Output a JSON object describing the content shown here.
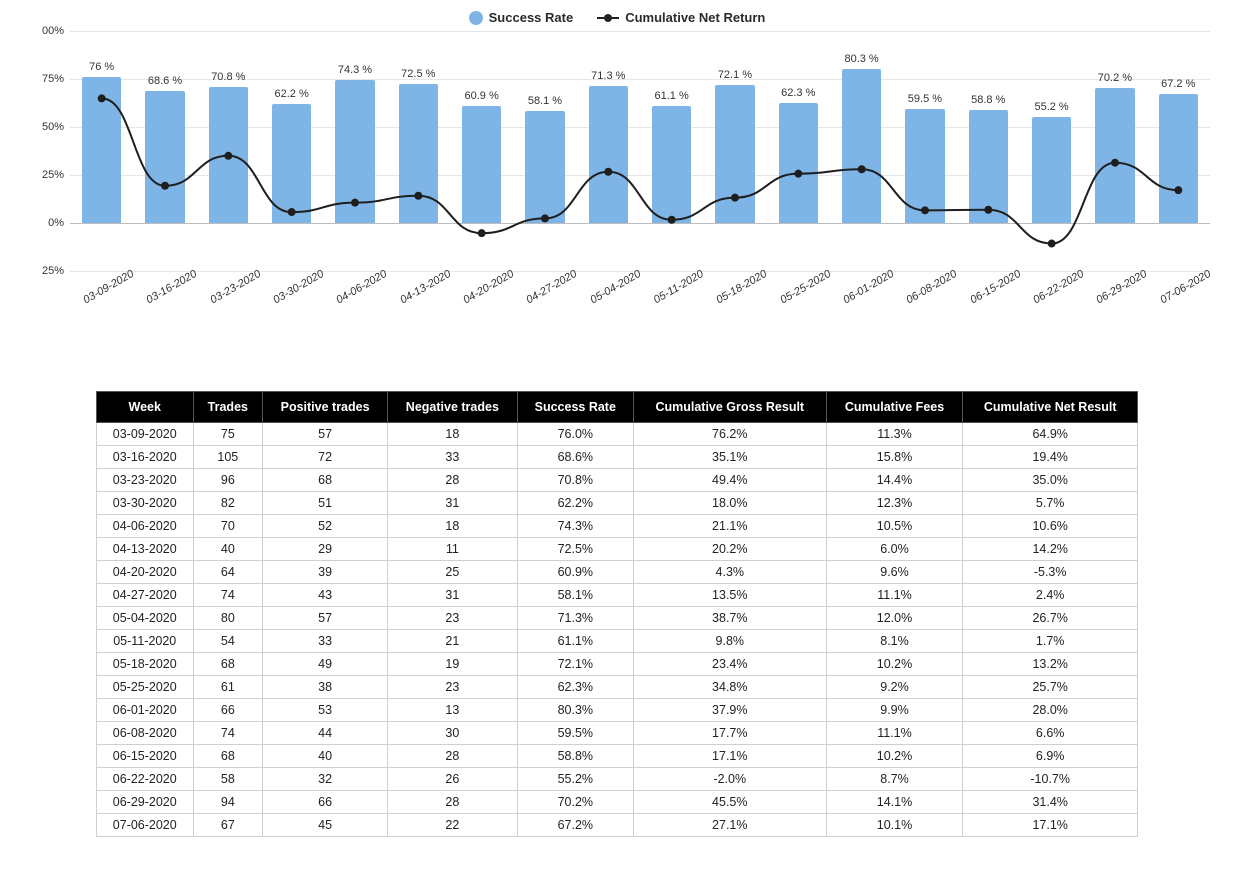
{
  "legend": {
    "bar_label": "Success Rate",
    "line_label": "Cumulative Net Return",
    "bar_color": "#7eb5e6",
    "line_color": "#1e1e1e"
  },
  "chart_data": {
    "type": "bar+line",
    "categories": [
      "03-09-2020",
      "03-16-2020",
      "03-23-2020",
      "03-30-2020",
      "04-06-2020",
      "04-13-2020",
      "04-20-2020",
      "04-27-2020",
      "05-04-2020",
      "05-11-2020",
      "05-18-2020",
      "05-25-2020",
      "06-01-2020",
      "06-08-2020",
      "06-15-2020",
      "06-22-2020",
      "06-29-2020",
      "07-06-2020"
    ],
    "series": [
      {
        "name": "Success Rate",
        "kind": "bar",
        "values": [
          76.0,
          68.6,
          70.8,
          62.2,
          74.3,
          72.5,
          60.9,
          58.1,
          71.3,
          61.1,
          72.1,
          62.3,
          80.3,
          59.5,
          58.8,
          55.2,
          70.2,
          67.2
        ],
        "data_labels": [
          "76 %",
          "68.6 %",
          "70.8 %",
          "62.2 %",
          "74.3 %",
          "72.5 %",
          "60.9 %",
          "58.1 %",
          "71.3 %",
          "61.1 %",
          "72.1 %",
          "62.3 %",
          "80.3 %",
          "59.5 %",
          "58.8 %",
          "55.2 %",
          "70.2 %",
          "67.2 %"
        ]
      },
      {
        "name": "Cumulative Net Return",
        "kind": "line",
        "values": [
          64.9,
          19.4,
          35.0,
          5.7,
          10.6,
          14.2,
          -5.3,
          2.4,
          26.7,
          1.7,
          13.2,
          25.7,
          28.0,
          6.6,
          6.9,
          -10.7,
          31.4,
          17.1
        ]
      }
    ],
    "ylim": [
      -25,
      100
    ],
    "yticks": [
      -25,
      0,
      25,
      50,
      75,
      100
    ],
    "ytick_labels": [
      "25%",
      "0%",
      "25%",
      "50%",
      "75%",
      "00%"
    ],
    "xlabel": "",
    "ylabel": ""
  },
  "table": {
    "headers": [
      "Week",
      "Trades",
      "Positive trades",
      "Negative trades",
      "Success Rate",
      "Cumulative Gross Result",
      "Cumulative Fees",
      "Cumulative Net Result"
    ],
    "rows": [
      {
        "week": "03-09-2020",
        "trades": "75",
        "pos": "57",
        "neg": "18",
        "rate": "76.0%",
        "gross": "76.2%",
        "fees": "11.3%",
        "net": "64.9%"
      },
      {
        "week": "03-16-2020",
        "trades": "105",
        "pos": "72",
        "neg": "33",
        "rate": "68.6%",
        "gross": "35.1%",
        "fees": "15.8%",
        "net": "19.4%"
      },
      {
        "week": "03-23-2020",
        "trades": "96",
        "pos": "68",
        "neg": "28",
        "rate": "70.8%",
        "gross": "49.4%",
        "fees": "14.4%",
        "net": "35.0%"
      },
      {
        "week": "03-30-2020",
        "trades": "82",
        "pos": "51",
        "neg": "31",
        "rate": "62.2%",
        "gross": "18.0%",
        "fees": "12.3%",
        "net": "5.7%"
      },
      {
        "week": "04-06-2020",
        "trades": "70",
        "pos": "52",
        "neg": "18",
        "rate": "74.3%",
        "gross": "21.1%",
        "fees": "10.5%",
        "net": "10.6%"
      },
      {
        "week": "04-13-2020",
        "trades": "40",
        "pos": "29",
        "neg": "11",
        "rate": "72.5%",
        "gross": "20.2%",
        "fees": "6.0%",
        "net": "14.2%"
      },
      {
        "week": "04-20-2020",
        "trades": "64",
        "pos": "39",
        "neg": "25",
        "rate": "60.9%",
        "gross": "4.3%",
        "fees": "9.6%",
        "net": "-5.3%"
      },
      {
        "week": "04-27-2020",
        "trades": "74",
        "pos": "43",
        "neg": "31",
        "rate": "58.1%",
        "gross": "13.5%",
        "fees": "11.1%",
        "net": "2.4%"
      },
      {
        "week": "05-04-2020",
        "trades": "80",
        "pos": "57",
        "neg": "23",
        "rate": "71.3%",
        "gross": "38.7%",
        "fees": "12.0%",
        "net": "26.7%"
      },
      {
        "week": "05-11-2020",
        "trades": "54",
        "pos": "33",
        "neg": "21",
        "rate": "61.1%",
        "gross": "9.8%",
        "fees": "8.1%",
        "net": "1.7%"
      },
      {
        "week": "05-18-2020",
        "trades": "68",
        "pos": "49",
        "neg": "19",
        "rate": "72.1%",
        "gross": "23.4%",
        "fees": "10.2%",
        "net": "13.2%"
      },
      {
        "week": "05-25-2020",
        "trades": "61",
        "pos": "38",
        "neg": "23",
        "rate": "62.3%",
        "gross": "34.8%",
        "fees": "9.2%",
        "net": "25.7%"
      },
      {
        "week": "06-01-2020",
        "trades": "66",
        "pos": "53",
        "neg": "13",
        "rate": "80.3%",
        "gross": "37.9%",
        "fees": "9.9%",
        "net": "28.0%"
      },
      {
        "week": "06-08-2020",
        "trades": "74",
        "pos": "44",
        "neg": "30",
        "rate": "59.5%",
        "gross": "17.7%",
        "fees": "11.1%",
        "net": "6.6%"
      },
      {
        "week": "06-15-2020",
        "trades": "68",
        "pos": "40",
        "neg": "28",
        "rate": "58.8%",
        "gross": "17.1%",
        "fees": "10.2%",
        "net": "6.9%"
      },
      {
        "week": "06-22-2020",
        "trades": "58",
        "pos": "32",
        "neg": "26",
        "rate": "55.2%",
        "gross": "-2.0%",
        "fees": "8.7%",
        "net": "-10.7%"
      },
      {
        "week": "06-29-2020",
        "trades": "94",
        "pos": "66",
        "neg": "28",
        "rate": "70.2%",
        "gross": "45.5%",
        "fees": "14.1%",
        "net": "31.4%"
      },
      {
        "week": "07-06-2020",
        "trades": "67",
        "pos": "45",
        "neg": "22",
        "rate": "67.2%",
        "gross": "27.1%",
        "fees": "10.1%",
        "net": "17.1%"
      }
    ]
  }
}
